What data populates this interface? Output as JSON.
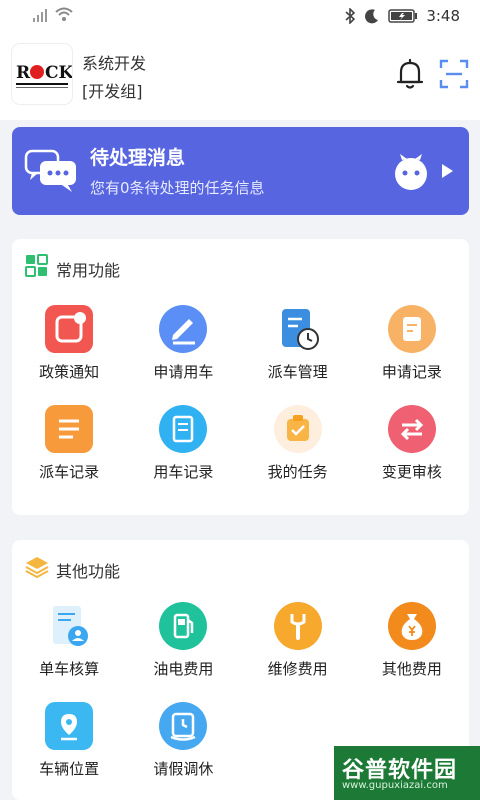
{
  "status_bar": {
    "time": "3:48"
  },
  "header": {
    "user_name": "系统开发",
    "user_group": "[开发组]",
    "logo_text": "ROCK"
  },
  "banner": {
    "title": "待处理消息",
    "subtitle": "您有0条待处理的任务信息"
  },
  "common": {
    "title": "常用功能",
    "items": [
      {
        "label": "政策通知",
        "color": "#f25650"
      },
      {
        "label": "申请用车",
        "color": "#5b8ff5"
      },
      {
        "label": "派车管理",
        "color": "#3c8fe0"
      },
      {
        "label": "申请记录",
        "color": "#f7b265"
      },
      {
        "label": "派车记录",
        "color": "#f79a3b"
      },
      {
        "label": "用车记录",
        "color": "#30b2f2"
      },
      {
        "label": "我的任务",
        "color": "#f8b545"
      },
      {
        "label": "变更审核",
        "color": "#ef6172"
      }
    ]
  },
  "other": {
    "title": "其他功能",
    "items": [
      {
        "label": "单车核算",
        "color": "#3aa7f0"
      },
      {
        "label": "油电费用",
        "color": "#1fc29b"
      },
      {
        "label": "维修费用",
        "color": "#f7a92d"
      },
      {
        "label": "其他费用",
        "color": "#f28a1c"
      },
      {
        "label": "车辆位置",
        "color": "#3bb8f2"
      },
      {
        "label": "请假调休",
        "color": "#45a8f0"
      }
    ]
  },
  "watermark": {
    "top": "谷普软件园",
    "bottom": "www.gupuxiazai.com"
  }
}
